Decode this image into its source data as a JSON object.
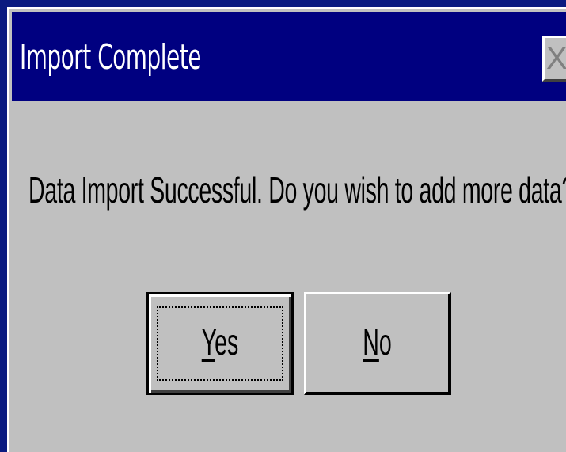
{
  "dialog": {
    "title": "Import Complete",
    "close_glyph": "X",
    "message": "Data Import Successful. Do you wish to add more data?",
    "buttons": {
      "yes": {
        "mnemonic": "Y",
        "rest": "es",
        "default": true
      },
      "no": {
        "mnemonic": "N",
        "rest": "o",
        "default": false
      }
    }
  },
  "colors": {
    "titlebar": "#000080",
    "dialog_face": "#c0c0c0",
    "desktop": "#0a1a80"
  }
}
